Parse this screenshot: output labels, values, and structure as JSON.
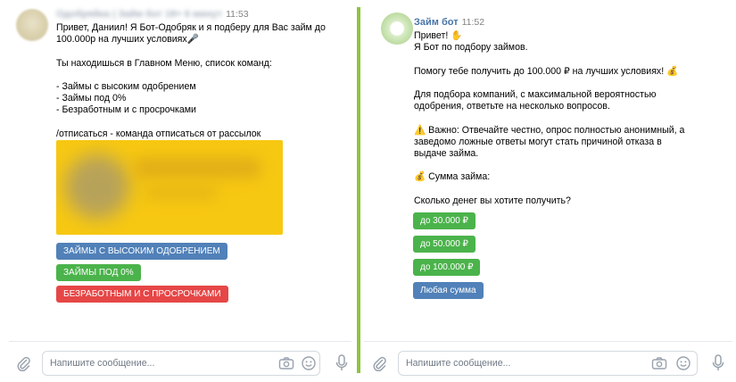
{
  "left_chat": {
    "sender": "Одобряйка | Займ бот 18+ 6 минут",
    "time": "11:53",
    "message": "Привет, Даниил! Я Бот-Одобряк и я подберу для Вас займ до\n100.000р на лучших условиях🎤\n\nТы находишься в Главном Меню, список команд:\n\n- Займы с высоким одобрением\n- Займы под 0%\n- Безработным и с просрочками\n\n/отписаться - команда отписаться от рассылок",
    "buttons": [
      {
        "label": "ЗАЙМЫ С ВЫСОКИМ ОДОБРЕНИЕМ",
        "color": "#5181b8"
      },
      {
        "label": "ЗАЙМЫ ПОД 0%",
        "color": "#4bb34b"
      },
      {
        "label": "БЕЗРАБОТНЫМ И С ПРОСРОЧКАМИ",
        "color": "#e64646"
      }
    ],
    "composer_placeholder": "Напишите сообщение..."
  },
  "right_chat": {
    "sender": "Займ бот",
    "time": "11:52",
    "message": "Привет! ✋\nЯ Бот по подбору займов.\n\nПомогу тебе получить до 100.000 ₽ на лучших условиях! 💰\n\nДля подбора компаний, с максимальной вероятностью\nодобрения, ответьте на несколько вопросов.\n\n⚠️ Важно: Отвечайте честно, опрос полностью анонимный, а\nзаведомо ложные ответы могут стать причиной отказа в\nвыдаче займа.\n\n💰 Сумма займа:\n\nСколько денег вы хотите получить?",
    "buttons": [
      {
        "label": "до 30.000 ₽",
        "color": "#4bb34b"
      },
      {
        "label": "до 50.000 ₽",
        "color": "#4bb34b"
      },
      {
        "label": "до 100.000 ₽",
        "color": "#4bb34b"
      },
      {
        "label": "Любая сумма",
        "color": "#5181b8"
      }
    ],
    "composer_placeholder": "Напишите сообщение..."
  },
  "colors": {
    "divider": "#8fc33f",
    "link_blue": "#5181b8",
    "green": "#4bb34b",
    "red": "#e64646"
  },
  "icons": [
    "paperclip-icon",
    "camera-icon",
    "emoji-icon",
    "microphone-icon"
  ]
}
